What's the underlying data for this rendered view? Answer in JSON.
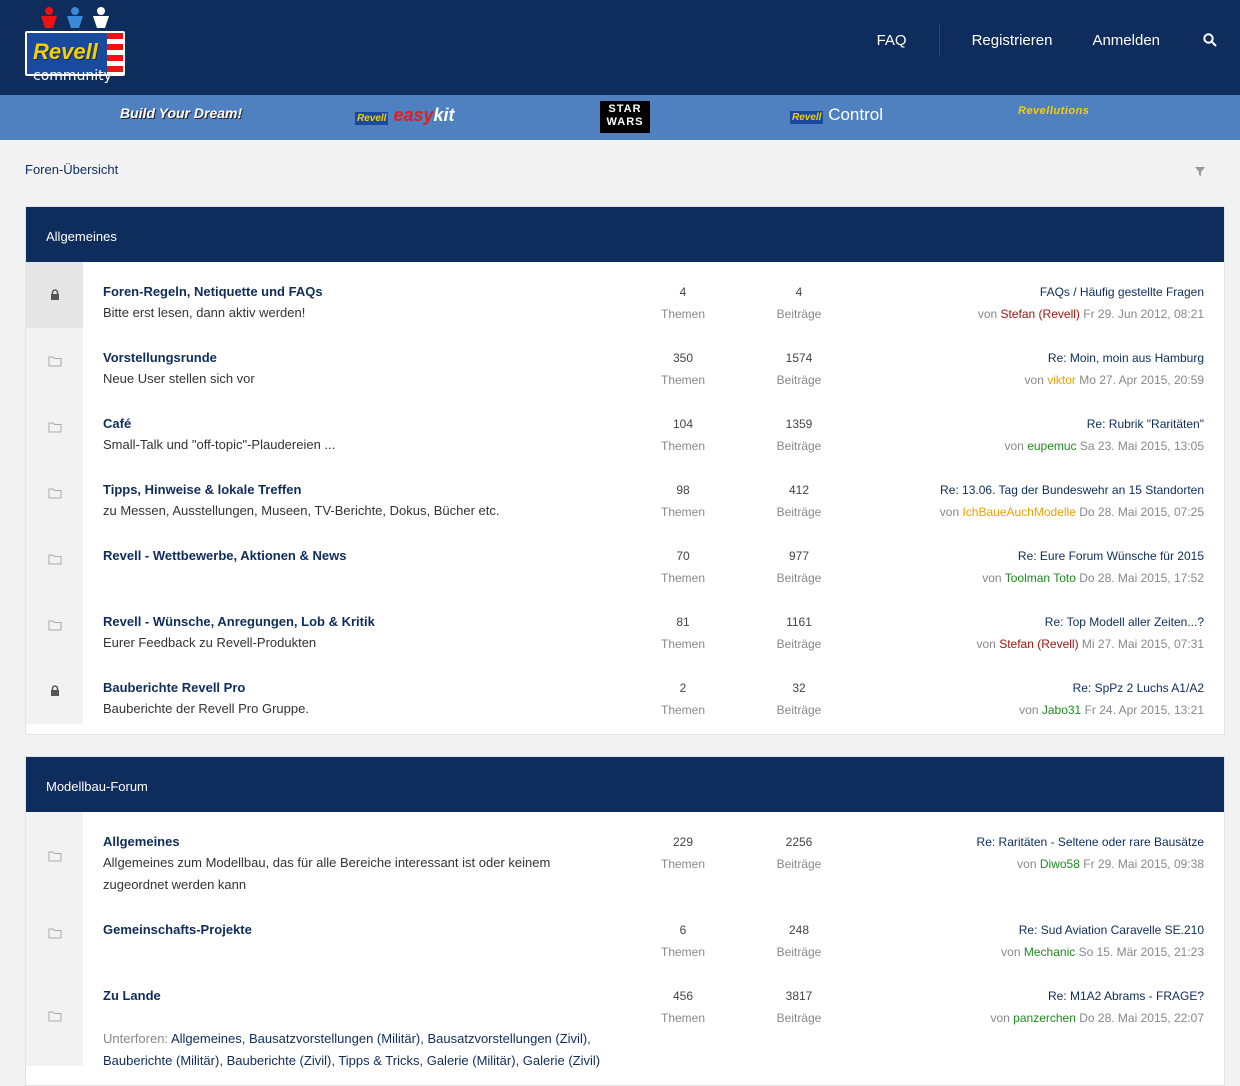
{
  "header": {
    "logo_text": "Revell",
    "logo_sub": "community",
    "nav": {
      "faq": "FAQ",
      "register": "Registrieren",
      "login": "Anmelden"
    }
  },
  "brands": {
    "dream": "Build Your Dream!",
    "easy_revell": "Revell",
    "easy": "easy",
    "easy_kit": "kit",
    "starwars_1": "STAR",
    "starwars_2": "WARS",
    "control_revell": "Revell",
    "control": "Control",
    "revolutions": "Revellutions"
  },
  "breadcrumb": "Foren-Übersicht",
  "colors": {
    "header_bg": "#0e2c5c",
    "brandbar_bg": "#4f80c0",
    "user_red": "#a0140f",
    "user_orange": "#f0a000",
    "user_green": "#1e8c1e"
  },
  "stats_labels": {
    "threads": "Themen",
    "posts": "Beiträge",
    "by": "von"
  },
  "categories": [
    {
      "title": "Allgemeines",
      "forums": [
        {
          "title": "Foren-Regeln, Netiquette und FAQs",
          "desc": "Bitte erst lesen, dann aktiv werden!",
          "icon": "lock-icon",
          "threads": "4",
          "posts": "4",
          "last_title": "FAQs / Häufig gestellte Fragen",
          "last_user": "Stefan (Revell)",
          "last_user_color": "#a0140f",
          "last_date": "Fr 29. Jun 2012, 08:21"
        },
        {
          "title": "Vorstellungsrunde",
          "desc": "Neue User stellen sich vor",
          "icon": "folder-icon",
          "threads": "350",
          "posts": "1574",
          "last_title": "Re: Moin, moin aus Hamburg",
          "last_user": "viktor",
          "last_user_color": "#f0a000",
          "last_date": "Mo 27. Apr 2015, 20:59"
        },
        {
          "title": "Café",
          "desc": "Small-Talk und \"off-topic\"-Plaudereien ...",
          "icon": "folder-icon",
          "threads": "104",
          "posts": "1359",
          "last_title": "Re: Rubrik \"Raritäten\"",
          "last_user": "eupemuc",
          "last_user_color": "#1e8c1e",
          "last_date": "Sa 23. Mai 2015, 13:05"
        },
        {
          "title": "Tipps, Hinweise & lokale Treffen",
          "desc": "zu Messen, Ausstellungen, Museen, TV-Berichte, Dokus, Bücher etc.",
          "icon": "folder-icon",
          "threads": "98",
          "posts": "412",
          "last_title": "Re: 13.06. Tag der Bundeswehr an 15 Standorten",
          "last_user": "IchBaueAuchModelle",
          "last_user_color": "#f0a000",
          "last_date": "Do 28. Mai 2015, 07:25"
        },
        {
          "title": "Revell - Wettbewerbe, Aktionen & News",
          "desc": "",
          "icon": "folder-icon",
          "threads": "70",
          "posts": "977",
          "last_title": "Re: Eure Forum Wünsche für 2015",
          "last_user": "Toolman Toto",
          "last_user_color": "#1e8c1e",
          "last_date": "Do 28. Mai 2015, 17:52"
        },
        {
          "title": "Revell - Wünsche, Anregungen, Lob & Kritik",
          "desc": "Eurer Feedback zu Revell-Produkten",
          "icon": "folder-icon",
          "threads": "81",
          "posts": "1161",
          "last_title": "Re: Top Modell aller Zeiten...?",
          "last_user": "Stefan (Revell)",
          "last_user_color": "#a0140f",
          "last_date": "Mi 27. Mai 2015, 07:31"
        },
        {
          "title": "Bauberichte Revell Pro",
          "desc": "Bauberichte der Revell Pro Gruppe.",
          "icon": "lock-icon",
          "threads": "2",
          "posts": "32",
          "last_title": "Re: SpPz 2 Luchs A1/A2",
          "last_user": "Jabo31",
          "last_user_color": "#1e8c1e",
          "last_date": "Fr 24. Apr 2015, 13:21"
        }
      ]
    },
    {
      "title": "Modellbau-Forum",
      "forums": [
        {
          "title": "Allgemeines",
          "desc": "Allgemeines zum Modellbau, das für alle Bereiche interessant ist oder keinem zugeordnet werden kann",
          "icon": "folder-icon",
          "threads": "229",
          "posts": "2256",
          "last_title": "Re: Raritäten - Seltene oder rare Bausätze",
          "last_user": "Diwo58",
          "last_user_color": "#1e8c1e",
          "last_date": "Fr 29. Mai 2015, 09:38"
        },
        {
          "title": "Gemeinschafts-Projekte",
          "desc": "",
          "icon": "folder-icon",
          "threads": "6",
          "posts": "248",
          "last_title": "Re: Sud Aviation Caravelle SE.210",
          "last_user": "Mechanic",
          "last_user_color": "#1e8c1e",
          "last_date": "So 15. Mär 2015, 21:23"
        },
        {
          "title": "Zu Lande",
          "desc": "",
          "icon": "folder-icon",
          "threads": "456",
          "posts": "3817",
          "last_title": "Re: M1A2 Abrams - FRAGE?",
          "last_user": "panzerchen",
          "last_user_color": "#1e8c1e",
          "last_date": "Do 28. Mai 2015, 22:07",
          "subforums_label": "Unterforen:",
          "subforums": [
            "Allgemeines",
            "Bausatzvorstellungen (Militär)",
            "Bausatzvorstellungen (Zivil)",
            "Bauberichte (Militär)",
            "Bauberichte (Zivil)",
            "Tipps & Tricks",
            "Galerie (Militär)",
            "Galerie (Zivil)"
          ]
        }
      ]
    }
  ]
}
